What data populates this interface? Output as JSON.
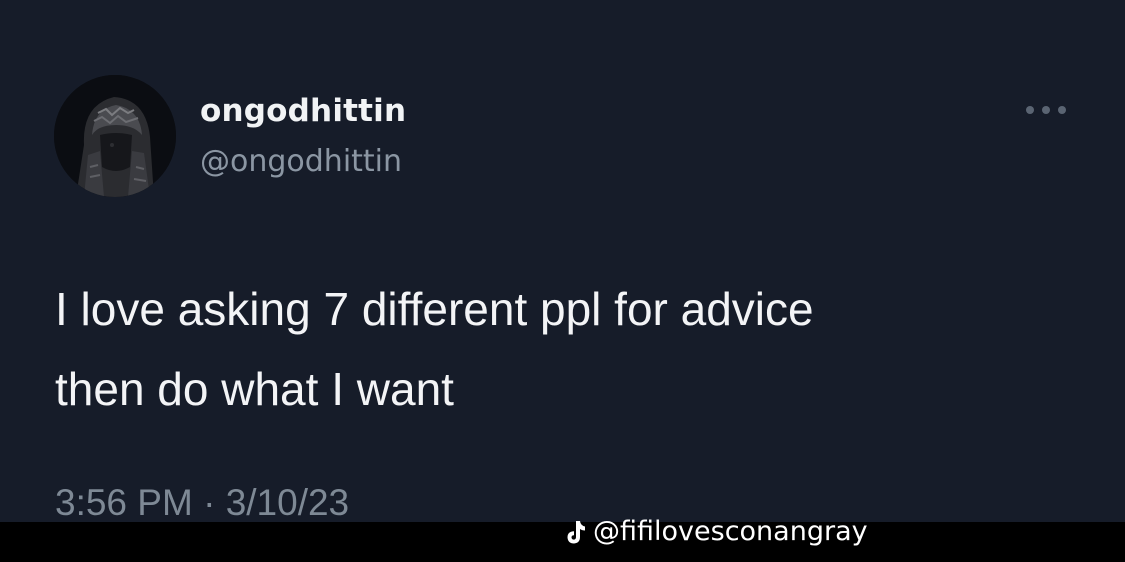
{
  "tweet": {
    "display_name": "ongodhittin",
    "handle": "@ongodhittin",
    "text_lines": [
      "I love asking 7 different ppl for advice",
      "then do what I want"
    ],
    "time": "3:56 PM",
    "separator": "·",
    "date": "3/10/23",
    "more_icon": "more-horizontal-icon"
  },
  "watermark": {
    "icon": "tiktok-icon",
    "text": "@fifilovesconangray"
  },
  "colors": {
    "background": "#161c29",
    "text": "#f3f4f6",
    "secondary_text": "#8b96a3",
    "watermark_bar": "#000000"
  }
}
